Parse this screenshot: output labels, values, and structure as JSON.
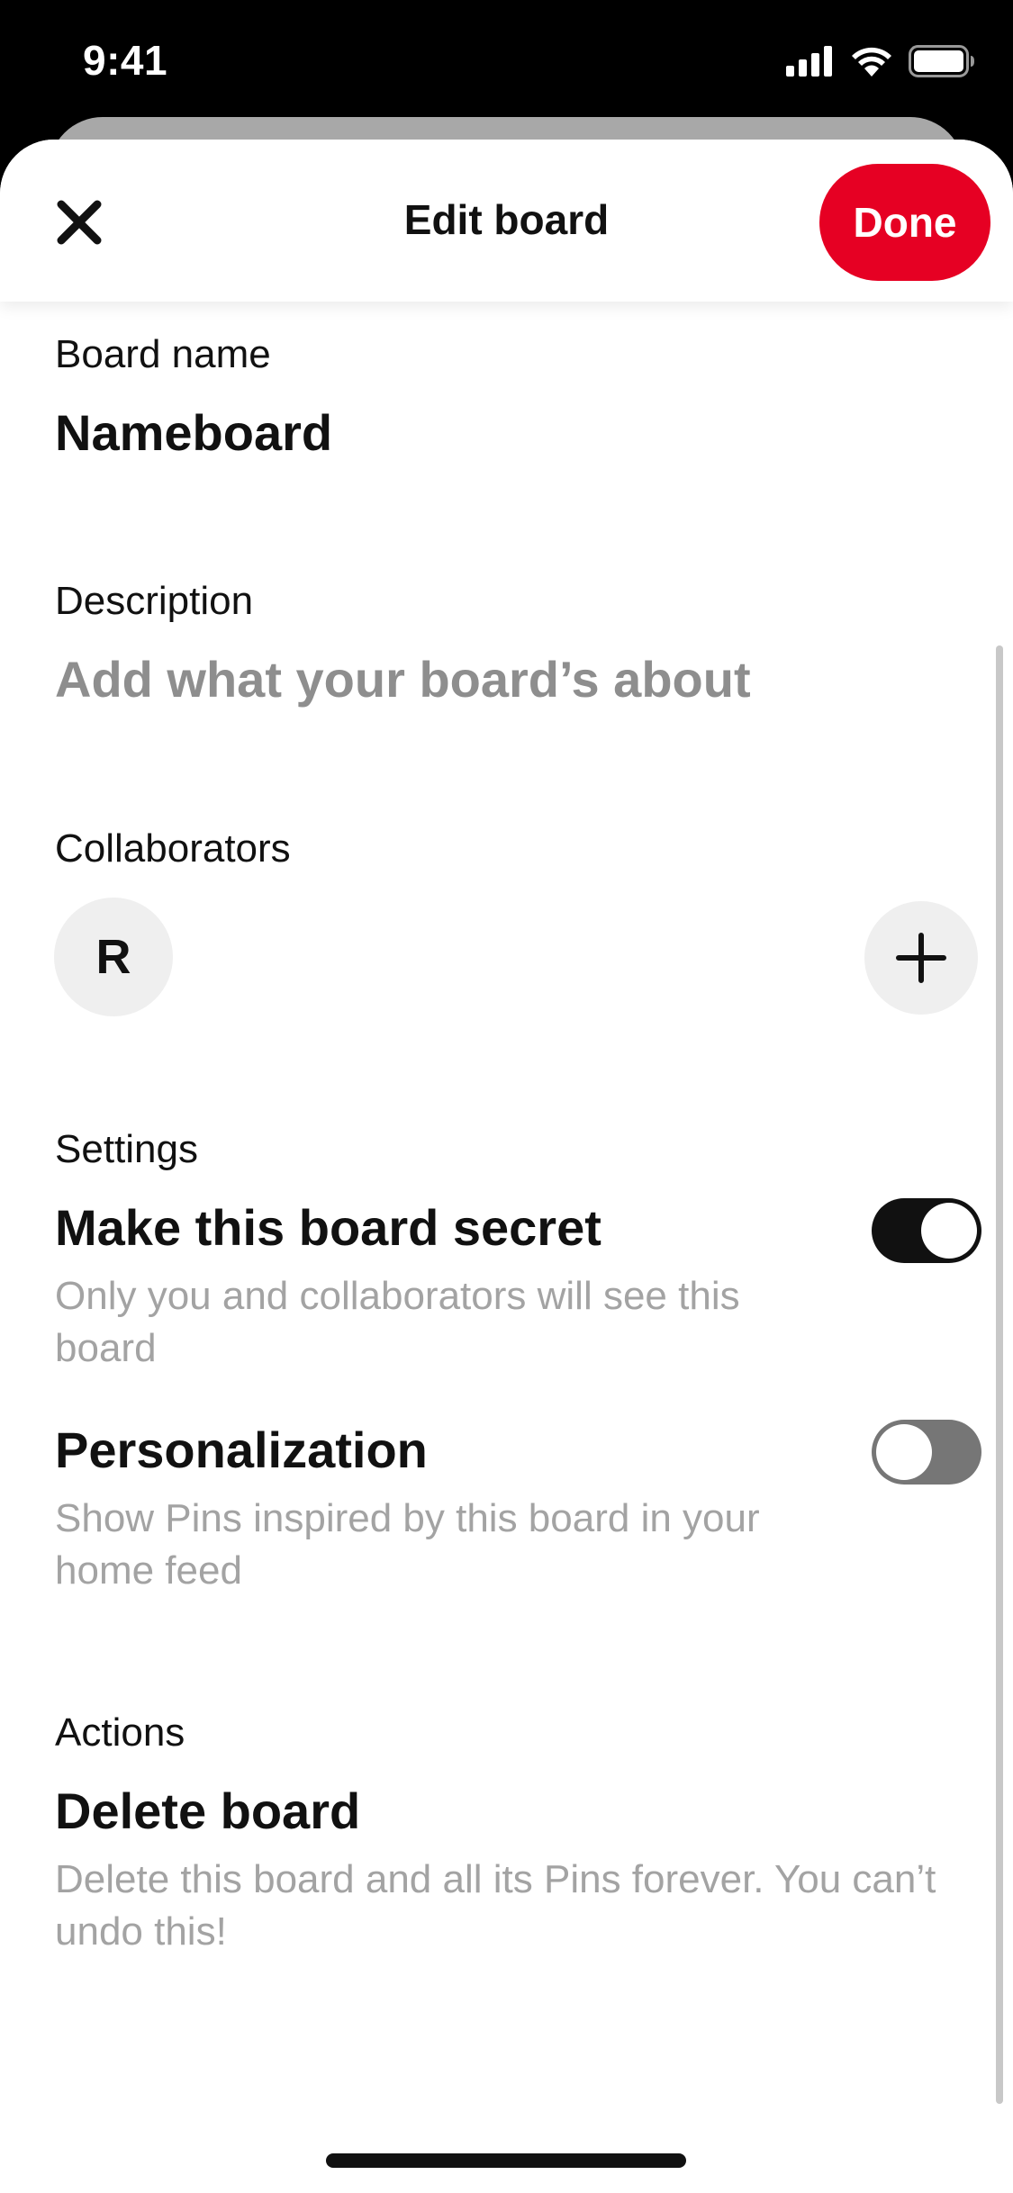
{
  "status_bar": {
    "time": "9:41",
    "icons": [
      "cellular-signal-icon",
      "wifi-icon",
      "battery-icon"
    ]
  },
  "header": {
    "title": "Edit board",
    "close_icon": "close-icon",
    "done_label": "Done"
  },
  "board_name": {
    "label": "Board name",
    "value": "Nameboard"
  },
  "description": {
    "label": "Description",
    "placeholder": "Add what your board’s about"
  },
  "collaborators": {
    "label": "Collaborators",
    "avatar_initial": "R",
    "add_icon": "plus-icon"
  },
  "settings": {
    "label": "Settings",
    "secret": {
      "title": "Make this board secret",
      "description": "Only you and collaborators will see this board",
      "enabled": true
    },
    "personalization": {
      "title": "Personalization",
      "description": "Show Pins inspired by this board in your home feed",
      "enabled": false
    }
  },
  "actions": {
    "label": "Actions",
    "delete": {
      "title": "Delete board",
      "description": "Delete this board and all its Pins forever. You can’t undo this!"
    }
  },
  "colors": {
    "accent": "#e60023",
    "text_primary": "#111111",
    "text_secondary": "#a3a3a3",
    "toggle_on": "#111111",
    "toggle_off": "#767676"
  }
}
